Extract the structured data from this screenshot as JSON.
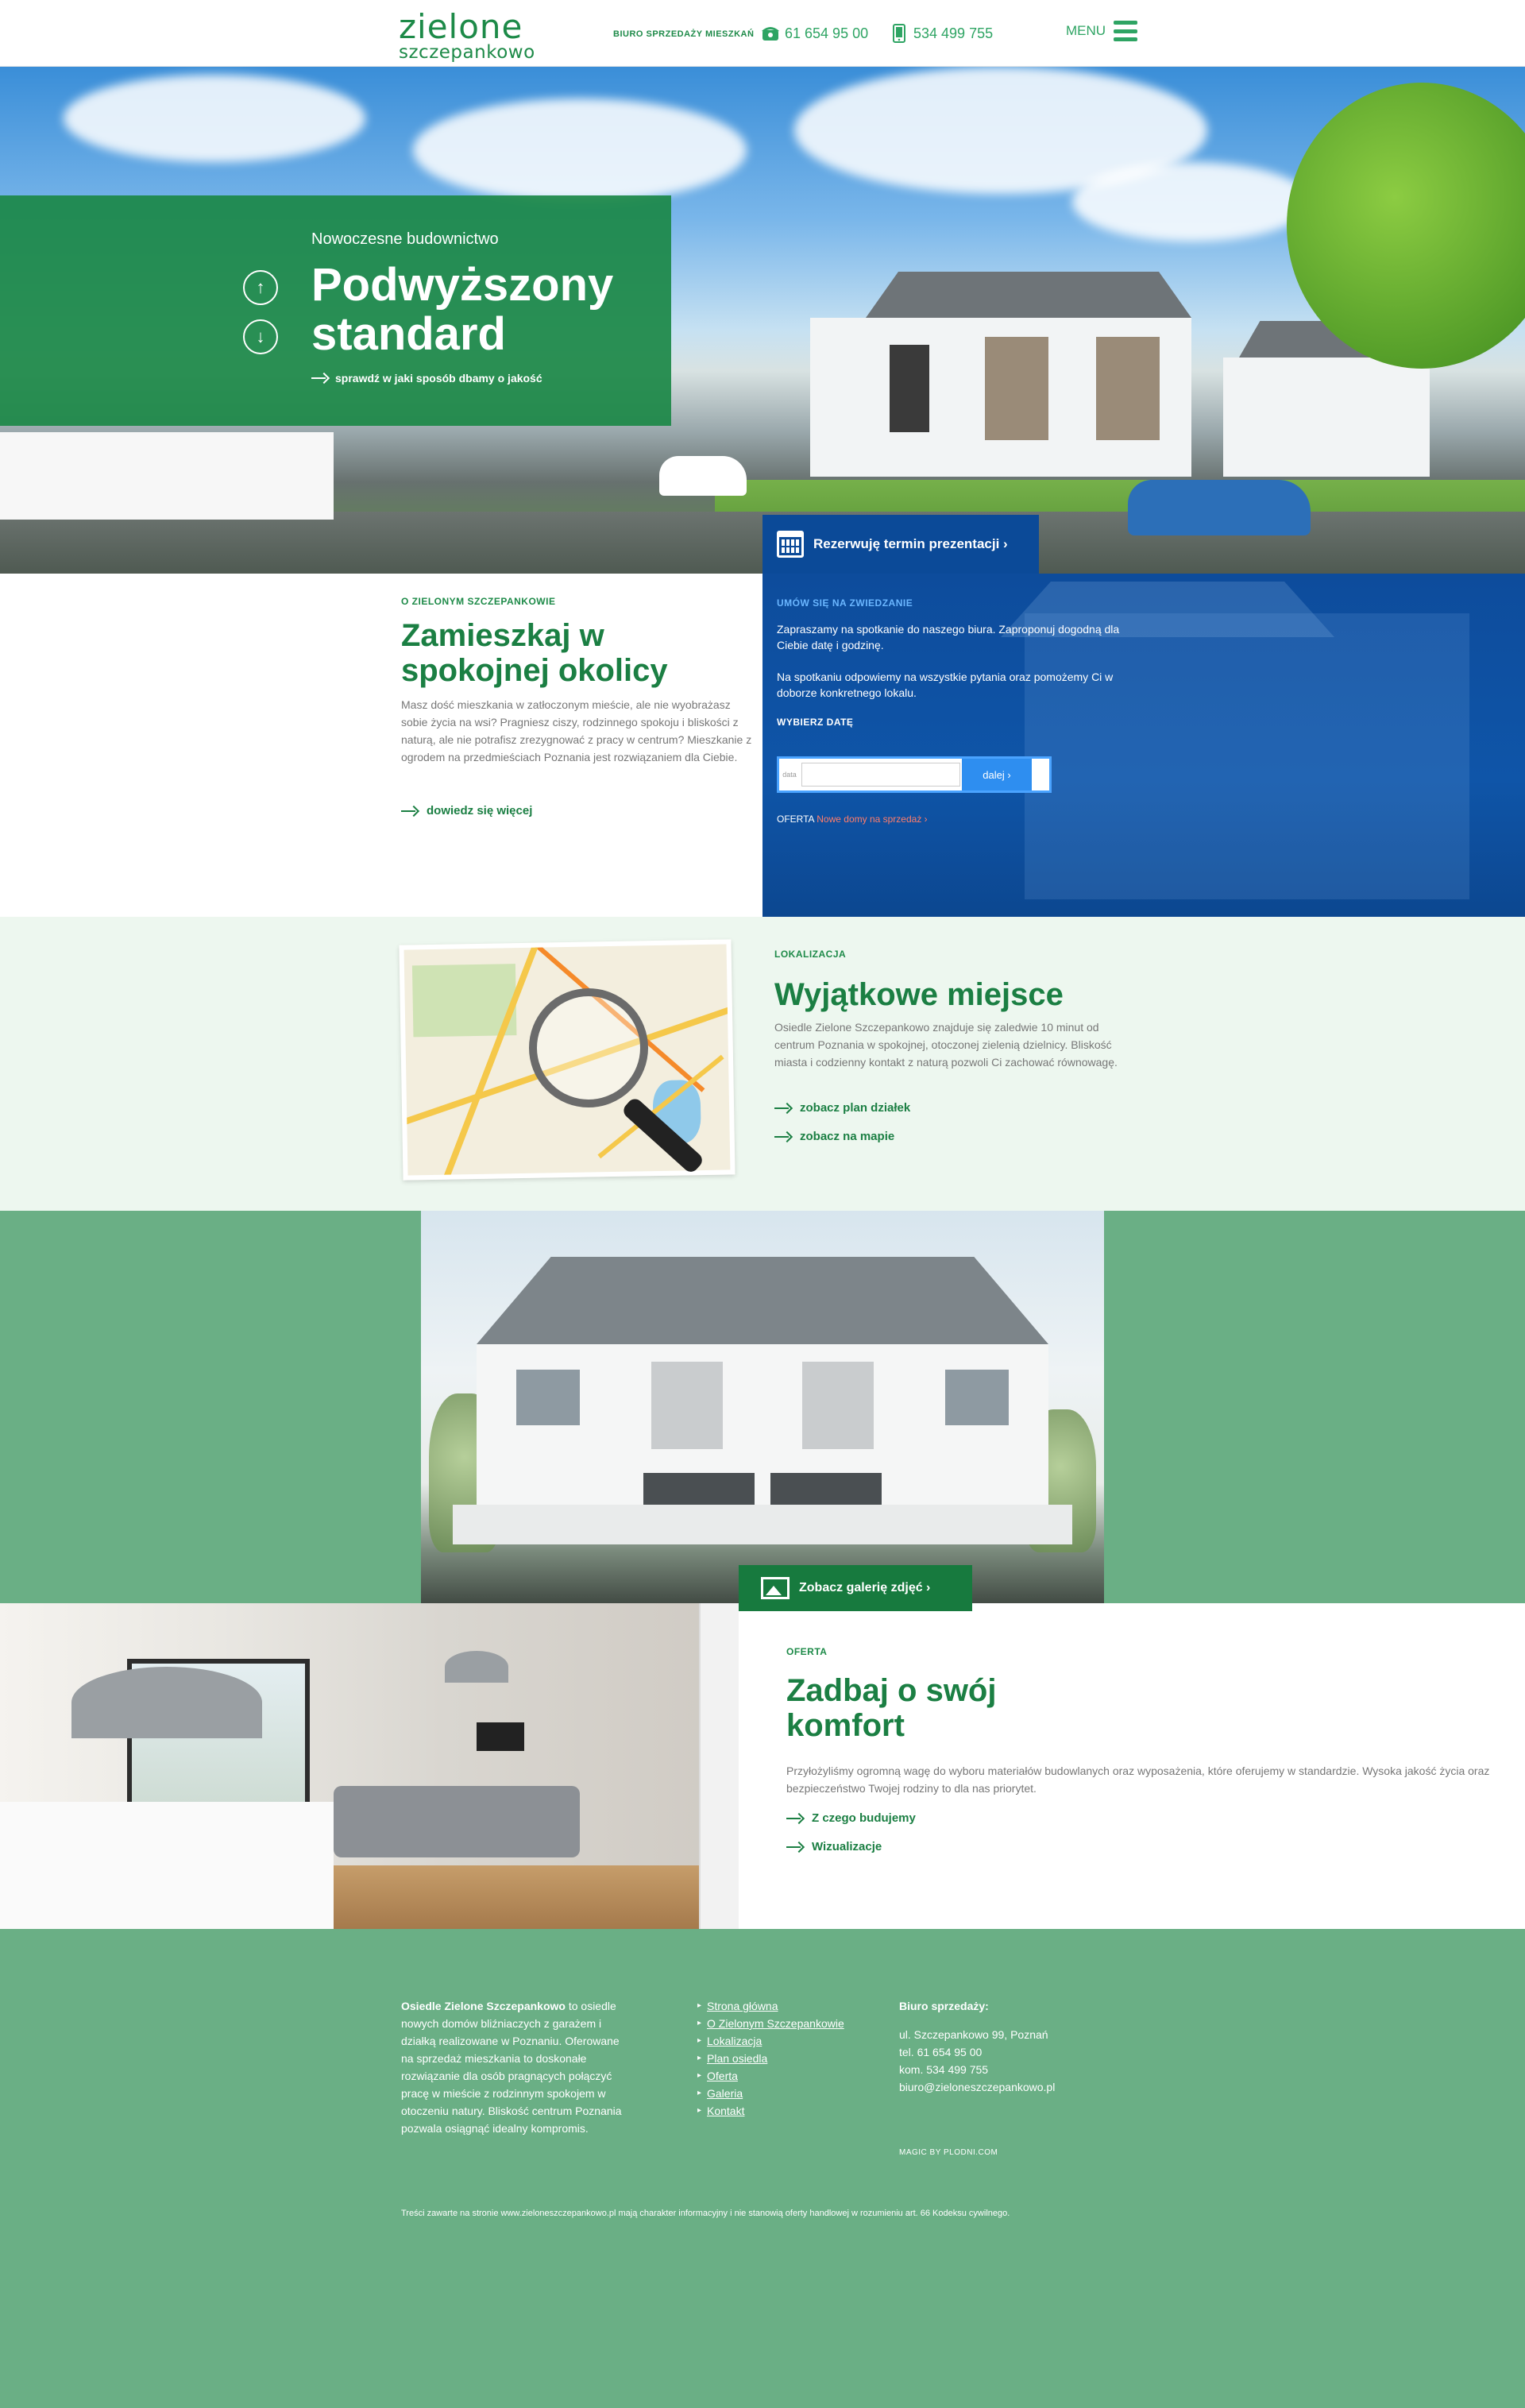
{
  "header": {
    "logo_top": "zielone",
    "logo_bottom": "szczepankowo",
    "office_label": "BIURO SPRZEDAŻY MIESZKAŃ",
    "phone1": "61 654 95 00",
    "phone2": "534 499 755",
    "menu_label": "MENU"
  },
  "hero": {
    "subtitle": "Nowoczesne budownictwo",
    "title_line1": "Podwyższony",
    "title_line2": "standard",
    "link": "sprawdź w jaki sposób dbamy o jakość",
    "reserve_button": "Rezerwuję termin prezentacji ›"
  },
  "about": {
    "label": "O ZIELONYM SZCZEPANKOWIE",
    "title": "Zamieszkaj w spokojnej okolicy",
    "text": "Masz dość mieszkania w zatłoczonym mieście, ale nie wyobrażasz sobie życia na wsi? Pragniesz ciszy, rodzinnego spokoju i bliskości z naturą, ale nie potrafisz zrezygnować z pracy w centrum? Mieszkanie z ogrodem na przedmieściach Poznania jest rozwiązaniem dla Ciebie.",
    "link": "dowiedz się więcej"
  },
  "booking": {
    "label": "UMÓW SIĘ NA ZWIEDZANIE",
    "text1": "Zapraszamy na spotkanie do naszego biura. Zaproponuj dogodną dla Ciebie datę i godzinę.",
    "text2": "Na spotkaniu odpowiemy na wszystkie pytania oraz pomożemy Ci w doborze konkretnego lokalu.",
    "pick_label": "WYBIERZ DATĘ",
    "date_label": "data",
    "date_value": "",
    "next_button": "dalej ›",
    "offer_prefix": "OFERTA",
    "offer_link": "Nowe domy na sprzedaż ›"
  },
  "location": {
    "label": "LOKALIZACJA",
    "title": "Wyjątkowe miejsce",
    "text": "Osiedle Zielone Szczepankowo znajduje się zaledwie 10 minut od centrum Poznania w spokojnej, otoczonej zielenią dzielnicy. Bliskość miasta i codzienny kontakt z naturą pozwoli Ci zachować równowagę.",
    "link1": "zobacz plan działek",
    "link2": "zobacz na mapie"
  },
  "gallery": {
    "button": "Zobacz galerię zdjęć ›"
  },
  "offer": {
    "label": "OFERTA",
    "title_line1": "Zadbaj o swój",
    "title_line2": "komfort",
    "text": "Przyłożyliśmy ogromną wagę do wyboru materiałów budowlanych oraz wyposażenia, które oferujemy w standardzie. Wysoka jakość życia oraz bezpieczeństwo Twojej rodziny to dla nas priorytet.",
    "link1": "Z czego budujemy",
    "link2": "Wizualizacje"
  },
  "footer": {
    "about_bold": "Osiedle Zielone Szczepankowo",
    "about_text": " to osiedle nowych domów bliźniaczych z garażem i działką realizowane w Poznaniu. Oferowane na sprzedaż mieszkania to doskonałe rozwiązanie dla osób pragnących połączyć pracę w mieście z rodzinnym spokojem w otoczeniu natury. Bliskość centrum Poznania pozwala osiągnąć idealny kompromis.",
    "nav": [
      "Strona główna",
      "O Zielonym Szczepankowie",
      "Lokalizacja",
      "Plan osiedla",
      "Oferta",
      "Galeria",
      "Kontakt"
    ],
    "contact_heading": "Biuro sprzedaży:",
    "address": "ul. Szczepankowo 99, Poznań",
    "tel": "tel. 61 654 95 00",
    "kom": "kom. 534 499 755",
    "email": "biuro@zieloneszczepankowo.pl",
    "credit": "MAGIC BY PLODNI.COM",
    "disclaimer": "Treści zawarte na stronie www.zieloneszczepankowo.pl mają charakter informacyjny i nie stanowią oferty handlowej w rozumieniu art. 66 Kodeksu cywilnego."
  }
}
